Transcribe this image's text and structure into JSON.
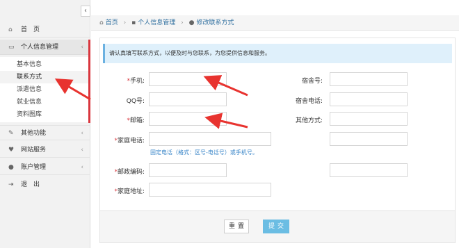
{
  "sidebar": {
    "collapse_glyph": "‹",
    "home": {
      "icon": "home-icon",
      "label": "首　页"
    },
    "personal": {
      "icon": "monitor-icon",
      "label": "个人信息管理",
      "chevron": "‹"
    },
    "submenu": [
      "基本信息",
      "联系方式",
      "派遣信息",
      "就业信息",
      "资料图库"
    ],
    "other": {
      "icon": "edit-icon",
      "label": "其他功能",
      "chevron": "‹"
    },
    "net": {
      "icon": "heart-icon",
      "label": "网站服务",
      "chevron": "‹"
    },
    "account": {
      "icon": "user-icon",
      "label": "账户管理",
      "chevron": "‹"
    },
    "logout": {
      "icon": "logout-icon",
      "label": "退　出"
    }
  },
  "breadcrumb": {
    "home": "首页",
    "section": "个人信息管理",
    "page": "修改联系方式",
    "sep": "›"
  },
  "form": {
    "notice": "请认真填写联系方式，以便及时与您联系，为您提供信息和服务。",
    "mobile": "手机:",
    "qq": "QQ号:",
    "email": "邮箱:",
    "home_phone": "家庭电话:",
    "home_phone_hint": "固定电话（格式：区号-电话号）或手机号。",
    "postcode": "邮政编码:",
    "address": "家庭地址:",
    "dorm_no": "宿舍号:",
    "dorm_phone": "宿舍电话:",
    "other_contact": "其他方式:",
    "required_mark": "*"
  },
  "buttons": {
    "reset": "重置",
    "submit": "提交"
  },
  "colors": {
    "accent": "#d9363e",
    "link": "#2f6f9f",
    "submit": "#6bbde3",
    "notice_bg": "#dff0fb"
  }
}
